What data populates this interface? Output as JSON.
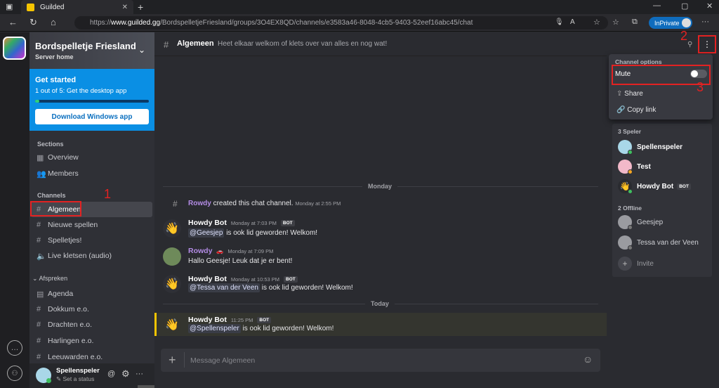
{
  "browser": {
    "tab_title": "Guilded",
    "tab_close": "✕",
    "new_tab": "+",
    "url_prefix": "https://",
    "url_host": "www.guilded.gg",
    "url_path": "/BordspelletjeFriesland/groups/3O4EX8QD/channels/e3583a46-8048-4cb5-9403-52eef16abc45/chat",
    "inprivate_label": "InPrivate",
    "back": "←",
    "reload": "↻",
    "home": "⌂",
    "more": "···",
    "minimize": "—",
    "maximize": "▢",
    "close": "✕"
  },
  "server": {
    "name": "Bordspelletje Friesland",
    "subtitle": "Server home"
  },
  "get_started": {
    "title": "Get started",
    "subtitle": "1 out of 5: Get the desktop app",
    "progress": 0.04,
    "button": "Download Windows app"
  },
  "sections": {
    "heading": "Sections",
    "items": [
      {
        "label": "Overview",
        "icon": "overview-icon"
      },
      {
        "label": "Members",
        "icon": "members-icon"
      }
    ]
  },
  "channels": {
    "heading": "Channels",
    "items": [
      {
        "label": "Algemeen",
        "icon": "hash-icon",
        "active": true
      },
      {
        "label": "Nieuwe spellen",
        "icon": "hash-icon"
      },
      {
        "label": "Spelletjes!",
        "icon": "hash-icon"
      },
      {
        "label": "Live kletsen (audio)",
        "icon": "speaker-icon"
      }
    ]
  },
  "afspreken": {
    "heading": "Afspreken",
    "items": [
      {
        "label": "Agenda",
        "icon": "calendar-icon"
      },
      {
        "label": "Dokkum e.o.",
        "icon": "hash-icon"
      },
      {
        "label": "Drachten e.o.",
        "icon": "hash-icon"
      },
      {
        "label": "Harlingen e.o.",
        "icon": "hash-icon"
      },
      {
        "label": "Leeuwarden e.o.",
        "icon": "hash-icon"
      }
    ]
  },
  "user": {
    "name": "Spellenspeler",
    "status": "Set a status"
  },
  "annotations": {
    "one": "1",
    "two": "2",
    "three": "3"
  },
  "channel_header": {
    "name": "Algemeen",
    "description": "Heet elkaar welkom of klets over van alles en nog wat!"
  },
  "chat": {
    "day_monday": "Monday",
    "day_today": "Today",
    "system": {
      "user": "Rowdy",
      "text": "created this chat channel.",
      "time": "Monday at 2:55 PM"
    },
    "messages": [
      {
        "author": "Howdy Bot",
        "time": "Monday at 7:03 PM",
        "bot": "BOT",
        "mention": "@Geesjep",
        "text": "is ook lid geworden! Welkom!"
      },
      {
        "author": "Rowdy",
        "time": "Monday at 7:09 PM",
        "bot": "",
        "mention": "",
        "text": "Hallo Geesje! Leuk dat je er bent!"
      },
      {
        "author": "Howdy Bot",
        "time": "Monday at 10:53 PM",
        "bot": "BOT",
        "mention": "@Tessa van der Veen",
        "text": "is ook lid geworden! Welkom!"
      },
      {
        "author": "Howdy Bot",
        "time": "11:25 PM",
        "bot": "BOT",
        "mention": "@Spellenspeler",
        "text": "is ook lid geworden! Welkom!"
      }
    ],
    "composer_placeholder": "Message Algemeen"
  },
  "channel_options": {
    "title": "Channel options",
    "mute": "Mute",
    "mute_on": false,
    "share": "Share",
    "copy_link": "Copy link"
  },
  "members": {
    "online_heading": "3 Speler",
    "online": [
      {
        "name": "Spellenspeler",
        "status": "online"
      },
      {
        "name": "Test",
        "status": "idle"
      },
      {
        "name": "Howdy Bot",
        "badge": "BOT",
        "status": "online"
      }
    ],
    "offline_heading": "2 Offline",
    "offline": [
      {
        "name": "Geesjep"
      },
      {
        "name": "Tessa van der Veen"
      }
    ],
    "invite": "Invite"
  },
  "colors": {
    "accent": "#f5c400",
    "highlight": "#e32222",
    "blue": "#0a8fe4"
  }
}
